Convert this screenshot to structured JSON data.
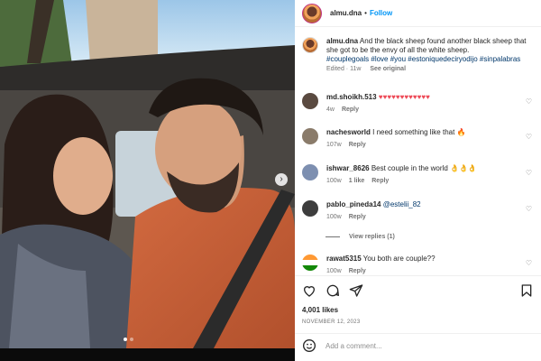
{
  "post": {
    "username": "almu.dna",
    "follow_label": "Follow",
    "caption_user": "almu.dna",
    "caption_text": "And the black sheep found another black sheep that she got to be the envy of all the white sheep.",
    "caption_tags": "#couplegoals #love #you #estoniquedeciryodijo #sinpalabras",
    "edited": "Edited · 11w",
    "see_original": "See original",
    "likes": "4,001 likes",
    "date": "NOVEMBER 12, 2023",
    "add_comment_placeholder": "Add a comment..."
  },
  "comments": [
    {
      "user": "md.shoikh.513",
      "text": "♥♥♥♥♥♥♥♥♥♥♥♥",
      "age": "4w",
      "likes": "",
      "reply": "Reply",
      "color": "#5a4a40"
    },
    {
      "user": "nachesworld",
      "text": "I need something like that 🔥",
      "age": "107w",
      "likes": "",
      "reply": "Reply",
      "color": "#8a7b6a"
    },
    {
      "user": "ishwar_8626",
      "text": "Best couple in the world 👌👌👌",
      "age": "100w",
      "likes": "1 like",
      "reply": "Reply",
      "color": "#7d8fb0"
    },
    {
      "user": "pablo_pineda14",
      "text": "@estelii_82",
      "age": "100w",
      "likes": "",
      "reply": "Reply",
      "color": "#3d3d3d"
    },
    {
      "user": "rawat5315",
      "text": "You both are couple??",
      "age": "100w",
      "likes": "",
      "reply": "Reply",
      "color": "#ff9933"
    }
  ],
  "view_replies": "View replies (1)",
  "colors": {
    "follow": "#0095f6",
    "muted": "#737373",
    "tag": "#00376b"
  },
  "icons": [
    "heart-icon",
    "comment-icon",
    "share-icon",
    "bookmark-icon",
    "emoji-icon",
    "next-arrow-icon"
  ]
}
